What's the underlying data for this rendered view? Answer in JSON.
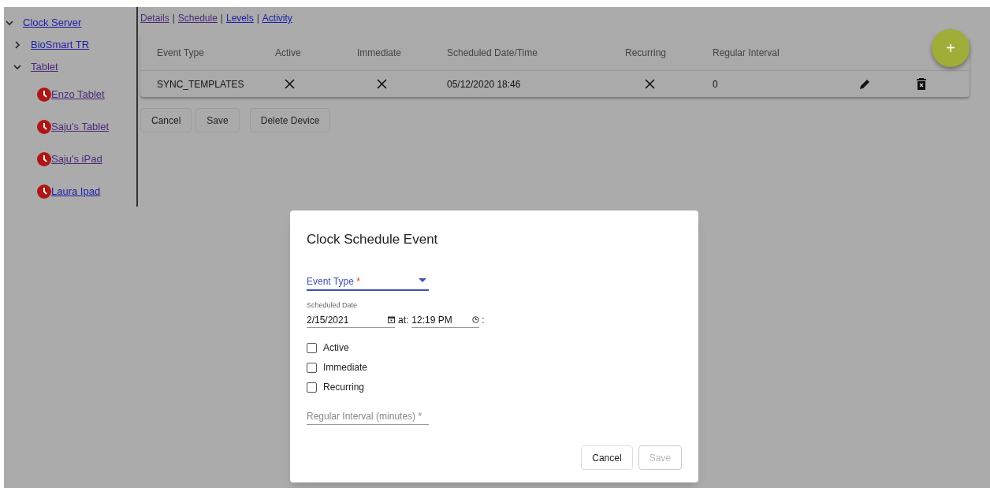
{
  "tree": [
    {
      "label": "Clock Server",
      "kind": "folder",
      "expanded": true,
      "visited": false,
      "children": [
        {
          "label": "BioSmart TR",
          "kind": "folder",
          "expanded": false,
          "visited": false
        },
        {
          "label": "Tablet",
          "kind": "folder",
          "expanded": true,
          "visited": true,
          "children": [
            {
              "label": "Enzo Tablet",
              "kind": "clock",
              "visited": true
            },
            {
              "label": "Saju's Tablet",
              "kind": "clock",
              "visited": true
            },
            {
              "label": "Saju's iPad",
              "kind": "clock",
              "visited": true
            },
            {
              "label": "Laura Ipad",
              "kind": "clock",
              "visited": false
            }
          ]
        }
      ]
    }
  ],
  "nav_links": [
    {
      "label": "Details",
      "visited": true
    },
    {
      "label": "Schedule",
      "visited": true
    },
    {
      "label": "Levels",
      "visited": false
    },
    {
      "label": "Activity",
      "visited": false
    }
  ],
  "nav_separator": "|",
  "table": {
    "columns": [
      "Event Type",
      "Active",
      "Immediate",
      "Scheduled Date/Time",
      "Recurring",
      "Regular Interval"
    ],
    "rows": [
      {
        "event_type": "SYNC_TEMPLATES",
        "active": false,
        "immediate": false,
        "scheduled": "05/12/2020 18:46",
        "recurring": false,
        "interval": "0"
      }
    ]
  },
  "add_button": "+",
  "buttons": [
    "Cancel",
    "Save",
    "Delete Device"
  ],
  "dialog": {
    "title": "Clock Schedule Event",
    "event_type": {
      "label": "Event Type",
      "required_mark": "*"
    },
    "date_label": "Scheduled Date",
    "date_value": "2/15/2021",
    "at_label": "at:",
    "time_value": "12:19 PM",
    "time_suffix": ":",
    "checkboxes": [
      {
        "label": "Active",
        "checked": false
      },
      {
        "label": "Immediate",
        "checked": false
      },
      {
        "label": "Recurring",
        "checked": false
      }
    ],
    "interval": {
      "placeholder": "Regular Interval (minutes) *"
    },
    "buttons": [
      {
        "label": "Cancel",
        "disabled": false
      },
      {
        "label": "Save",
        "disabled": true
      }
    ]
  }
}
